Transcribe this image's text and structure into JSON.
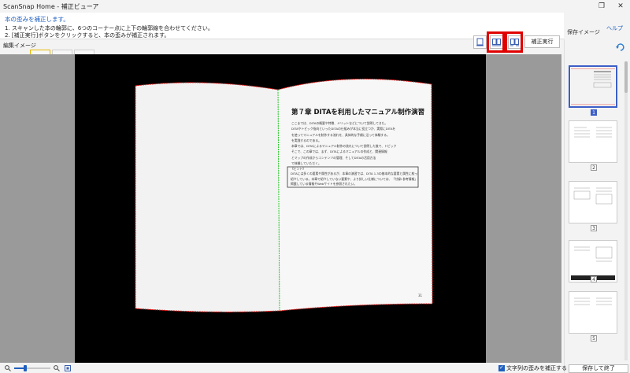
{
  "window": {
    "title": "ScanSnap Home - 補正ビューア",
    "restore_icon": "restore-icon",
    "close_icon": "close-icon"
  },
  "instructions": {
    "heading": "本の歪みを補正します。",
    "line1": "1. スキャンした本の輪郭に、6つのコーナー点に上下の輪郭線を合わせてください。",
    "line2": "2. [補正実行]ボタンをクリックすると、本の歪みが補正されます。"
  },
  "help_label": "ヘルプ",
  "edit_image_label": "編集イメージ",
  "save_image_label": "保存イメージ",
  "toolbar": {
    "apply_label": "補正実行",
    "highlight_color": "#e00000"
  },
  "book": {
    "heading": "第７章 DITAを利用したマニュアル制作演習",
    "body_lines": [
      "ここまでは、DITAの概要や特徴、メリットなどについて説明してきた。",
      "DITAやトピック指向といったDITAの仕組みが本当に役立つか、実際にDITAを",
      "を使ってマニュアルを制作する流れを、具体的な手順に沿って体験する。",
      "を実践するのである。",
      "本章では、DITAによるマニュアル制作の流れについて説明した後で、トピック",
      "そこで、この章では、まず、DITAによるマニュアルの作成と、関連情報",
      "とマップの作成からコンテンツの管理、そしてDITAの活用方法",
      "で体験していただく。"
    ],
    "hint_title": "《ヒント》",
    "hint_lines": [
      "DITAには多くの要素や属性があるが、本章の演習では、DITA 1.3の基本的な要素と属性に絞って",
      "紹介している。本章で紹介していない要素や、より詳しい仕様については、「付録Ⅰ 参考情報」に",
      "掲載している情報やWebサイトを参照されたい。"
    ],
    "page_number": "31"
  },
  "thumbnails": [
    {
      "num": "1",
      "selected": true
    },
    {
      "num": "2",
      "selected": false
    },
    {
      "num": "3",
      "selected": false
    },
    {
      "num": "4",
      "selected": false
    },
    {
      "num": "5",
      "selected": false
    }
  ],
  "bottom": {
    "checkbox_label": "文字列の歪みを補正する",
    "checked": true,
    "save_label": "保存して終了"
  },
  "colors": {
    "accent": "#1f5fbf",
    "outline_red": "#e02020",
    "outline_green": "#28d028"
  }
}
